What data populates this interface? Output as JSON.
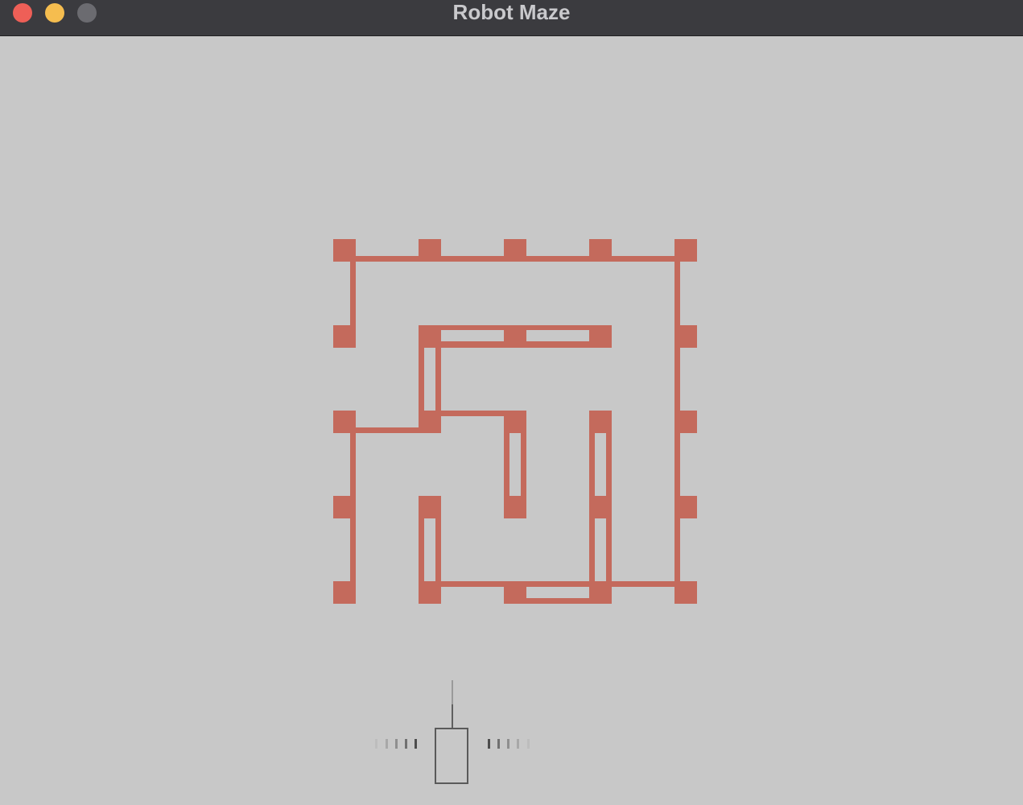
{
  "window": {
    "title": "Robot Maze",
    "controls": [
      "close",
      "minimize",
      "zoom"
    ]
  },
  "colors": {
    "titlebar": "#3b3b3f",
    "background": "#c8c8c8",
    "maze_wall": "#c46a5c",
    "robot_outline": "#5a5a5a"
  },
  "maze": {
    "grid": "5x5",
    "wall_color": "#c46a5c"
  },
  "robot": {
    "icon": "robot-body",
    "sensors": [
      "front-range-sensor",
      "left-range-sensor",
      "right-range-sensor"
    ]
  }
}
